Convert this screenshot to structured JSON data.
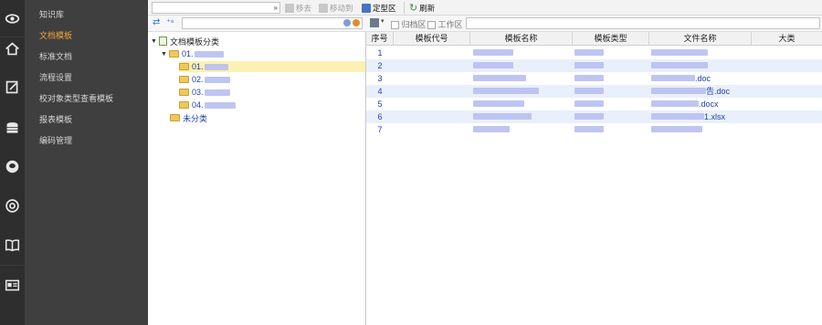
{
  "rail": {
    "icons": [
      "eye-icon",
      "home-icon",
      "edit-icon",
      "database-icon",
      "chat-icon",
      "target-icon",
      "book-icon",
      "id-card-icon"
    ]
  },
  "menu": {
    "items": [
      {
        "label": "知识库"
      },
      {
        "label": "文档模板",
        "active": true
      },
      {
        "label": "标准文档"
      },
      {
        "label": "流程设置"
      },
      {
        "label": "校对象类型查看模板"
      },
      {
        "label": "报表模板"
      },
      {
        "label": "编码管理"
      }
    ]
  },
  "toolbar": {
    "move_out": "移去",
    "move_to": "移动到",
    "archive": "定型区",
    "refresh": "刷新"
  },
  "tree": {
    "root": "文档模板分类",
    "group": "01.",
    "children": [
      "01.",
      "02.",
      "03.",
      "04."
    ],
    "uncategorized": "未分类"
  },
  "grid_tools": {
    "archive_check": "归档区",
    "work_check": "工作区"
  },
  "grid": {
    "columns": [
      "序号",
      "模板代号",
      "模板名称",
      "模板类型",
      "文件名称",
      "大类"
    ],
    "rows": [
      {
        "no": "1",
        "file_suffix": ""
      },
      {
        "no": "2",
        "file_suffix": ""
      },
      {
        "no": "3",
        "file_suffix": ".doc"
      },
      {
        "no": "4",
        "file_suffix": "告.doc"
      },
      {
        "no": "5",
        "file_suffix": ".docx"
      },
      {
        "no": "6",
        "file_suffix": "1.xlsx"
      },
      {
        "no": "7",
        "file_suffix": ""
      }
    ]
  },
  "colors": {
    "rail": "#2e2e2e",
    "menu": "#3f3f3f",
    "menu_active": "#f2a33a",
    "link": "#1f3fb0",
    "row_alt": "#e9f0fb",
    "tree_selected": "#fbf1b3"
  }
}
